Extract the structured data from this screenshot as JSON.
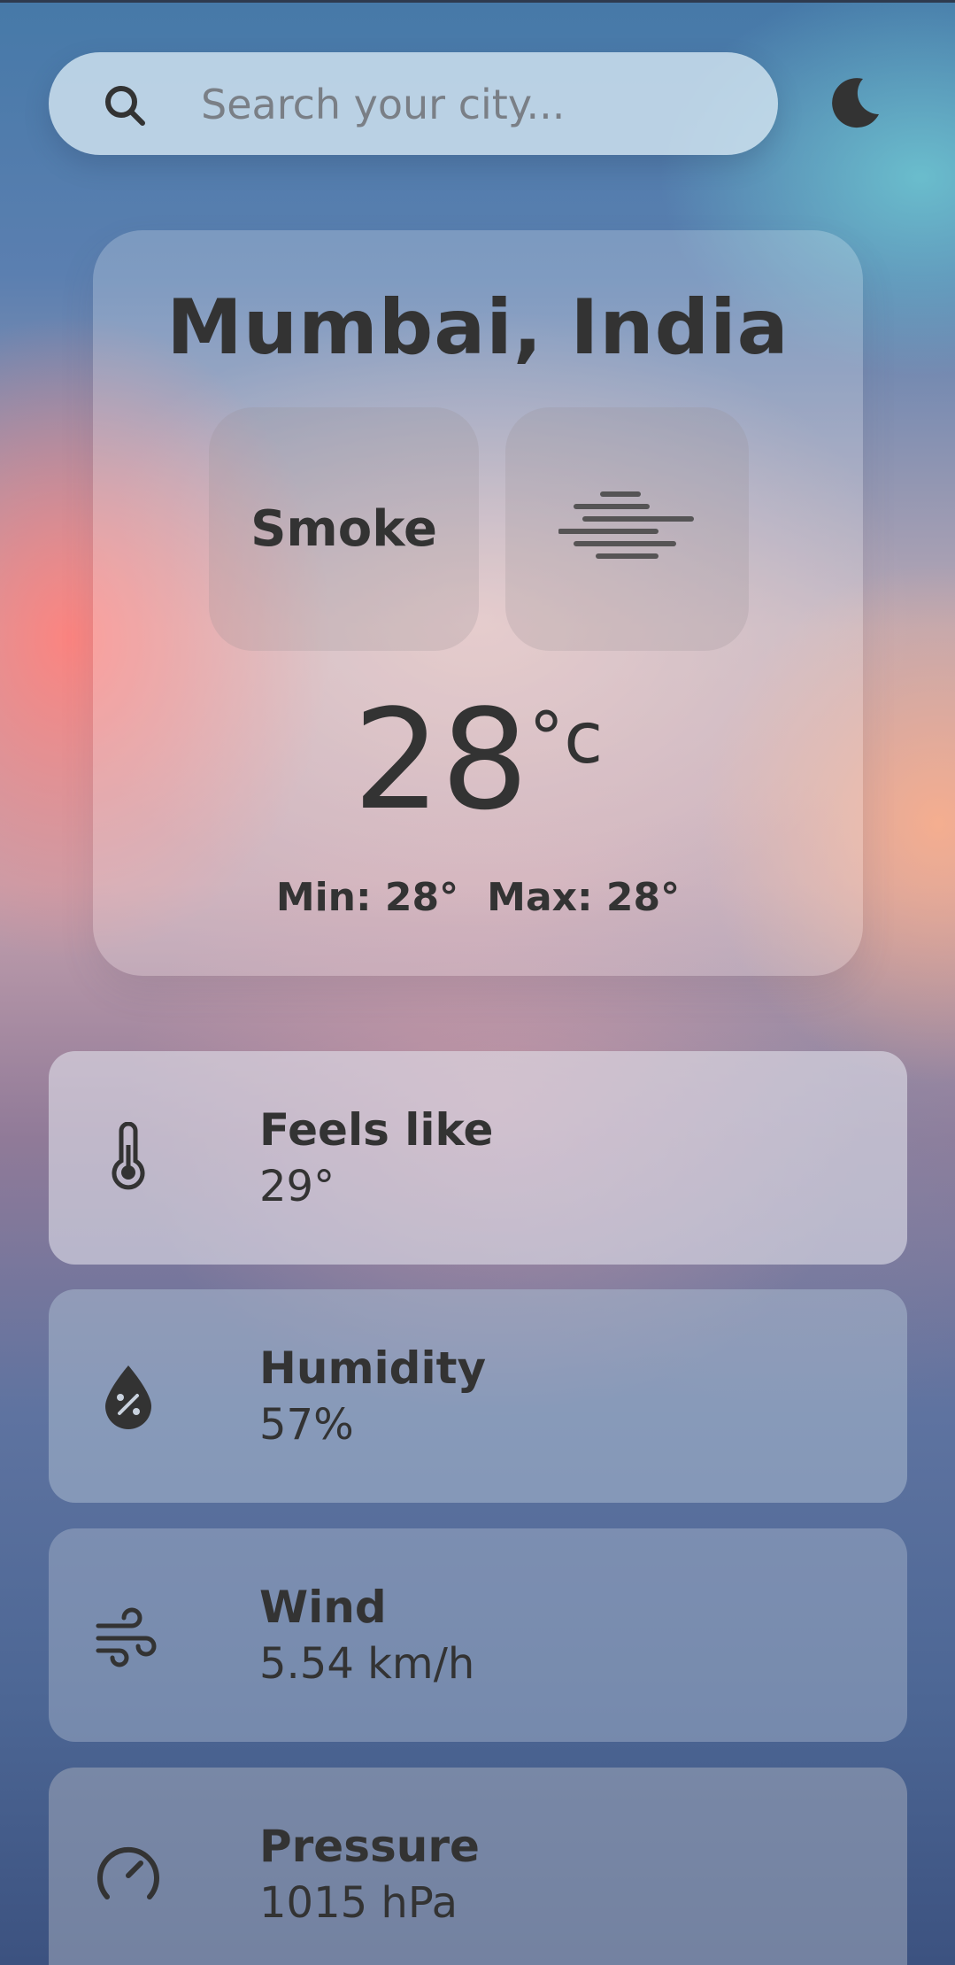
{
  "search": {
    "placeholder": "Search your city...",
    "icon": "search-icon"
  },
  "theme_toggle": {
    "icon": "moon-icon"
  },
  "weather": {
    "city": "Mumbai, India",
    "condition": "Smoke",
    "condition_icon": "haze-lines-icon",
    "temperature": "28",
    "temperature_unit": "°c",
    "min": "Min: 28°",
    "max": "Max: 28°"
  },
  "stats": [
    {
      "title": "Feels like",
      "value": "29°",
      "icon": "thermometer-icon"
    },
    {
      "title": "Humidity",
      "value": "57%",
      "icon": "humidity-drop-icon"
    },
    {
      "title": "Wind",
      "value": "5.54 km/h",
      "icon": "wind-icon"
    },
    {
      "title": "Pressure",
      "value": "1015 hPa",
      "icon": "gauge-icon"
    }
  ],
  "colors": {
    "text": "#333333",
    "search_bg": "#d2e4f0",
    "background_top": "#4679a8",
    "background_bottom": "#3c5280"
  }
}
